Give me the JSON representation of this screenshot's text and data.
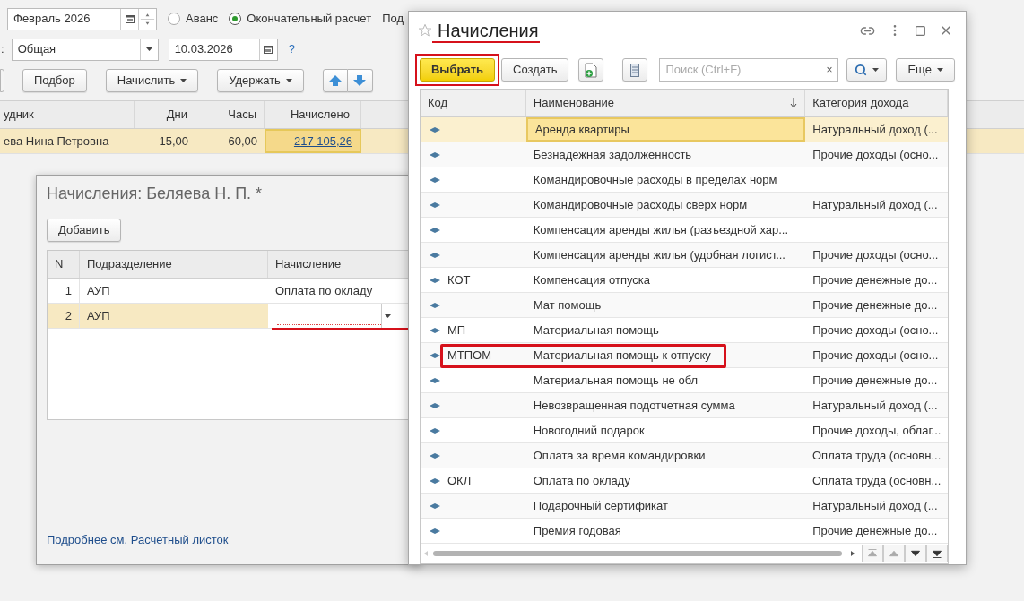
{
  "document": {
    "period": {
      "value": "Февраль 2026"
    },
    "payment_type": [
      {
        "label": "Аванс",
        "selected": false
      },
      {
        "label": "Окончательный расчет",
        "selected": true
      }
    ],
    "cut_label_right": "Под",
    "cut_label_left": ":",
    "kind_field": {
      "value": "Общая"
    },
    "date_field": {
      "value": "10.03.2026"
    },
    "help": "?",
    "buttons": [
      {
        "label": "Подбор",
        "dropdown": false
      },
      {
        "label": "Начислить",
        "dropdown": true
      },
      {
        "label": "Удержать",
        "dropdown": true
      }
    ],
    "table": {
      "columns": [
        "удник",
        "Дни",
        "Часы",
        "Начислено"
      ],
      "rows": [
        {
          "cells": [
            "ева Нина Петровна",
            "15,00",
            "60,00",
            "217 105,26"
          ],
          "selected": true
        }
      ]
    }
  },
  "accruals_form": {
    "title": "Начисления: Беляева Н. П. *",
    "add_button": "Добавить",
    "columns": [
      "N",
      "Подразделение",
      "Начисление"
    ],
    "rows": [
      {
        "n": "1",
        "department": "АУП",
        "accrual": "Оплата по окладу",
        "selected": false,
        "editing": false,
        "annotated": false
      },
      {
        "n": "2",
        "department": "АУП",
        "selected": true,
        "editing": true,
        "annotated": true
      }
    ],
    "link": "Подробнее см. Расчетный листок"
  },
  "picker": {
    "title": "Начисления",
    "title_annotated": true,
    "select_button": {
      "label": "Выбрать",
      "annotated": true
    },
    "create_button": "Создать",
    "search": {
      "placeholder": "Поиск (Ctrl+F)"
    },
    "clear": "×",
    "more_button": "Еще",
    "columns": [
      {
        "label": "Код",
        "sorted": false
      },
      {
        "label": "Наименование",
        "sorted": true
      },
      {
        "label": "Категория дохода",
        "sorted": false
      }
    ],
    "rows": [
      {
        "name": "Аренда квартиры",
        "category": "Натуральный доход (...",
        "selected": true,
        "annotated": false
      },
      {
        "name": "Безнадежная задолженность",
        "category": "Прочие доходы (осно...",
        "selected": false,
        "annotated": false
      },
      {
        "name": "Командировочные расходы в пределах норм",
        "selected": false,
        "annotated": false
      },
      {
        "name": "Командировочные расходы сверх норм",
        "category": "Натуральный доход (...",
        "selected": false,
        "annotated": false
      },
      {
        "name": "Компенсация аренды жилья (разъездной хар...",
        "selected": false,
        "annotated": false
      },
      {
        "name": "Компенсация аренды жилья (удобная логист...",
        "category": "Прочие доходы (осно...",
        "selected": false,
        "annotated": false
      },
      {
        "code": "КОТ",
        "name": "Компенсация отпуска",
        "category": "Прочие денежные до...",
        "selected": false,
        "annotated": false
      },
      {
        "name": "Мат помощь",
        "category": "Прочие денежные до...",
        "selected": false,
        "annotated": false
      },
      {
        "code": "МП",
        "name": "Материальная помощь",
        "category": "Прочие доходы (осно...",
        "selected": false,
        "annotated": false
      },
      {
        "code": "МТПОМ",
        "name": "Материальная помощь к отпуску",
        "category": "Прочие доходы (осно...",
        "selected": false,
        "annotated": true
      },
      {
        "name": "Материальная помощь не обл",
        "category": "Прочие денежные до...",
        "selected": false,
        "annotated": false
      },
      {
        "name": "Невозвращенная подотчетная сумма",
        "category": "Натуральный доход (...",
        "selected": false,
        "annotated": false
      },
      {
        "name": "Новогодний подарок",
        "category": "Прочие доходы, облаг...",
        "selected": false,
        "annotated": false
      },
      {
        "name": "Оплата за время командировки",
        "category": "Оплата труда (основн...",
        "selected": false,
        "annotated": false
      },
      {
        "code": "ОКЛ",
        "name": "Оплата по окладу",
        "category": "Оплата труда (основн...",
        "selected": false,
        "annotated": false
      },
      {
        "name": "Подарочный сертификат",
        "category": "Натуральный доход (...",
        "selected": false,
        "annotated": false
      },
      {
        "name": "Премия годовая",
        "category": "Прочие денежные до...",
        "selected": false,
        "annotated": false
      }
    ]
  }
}
